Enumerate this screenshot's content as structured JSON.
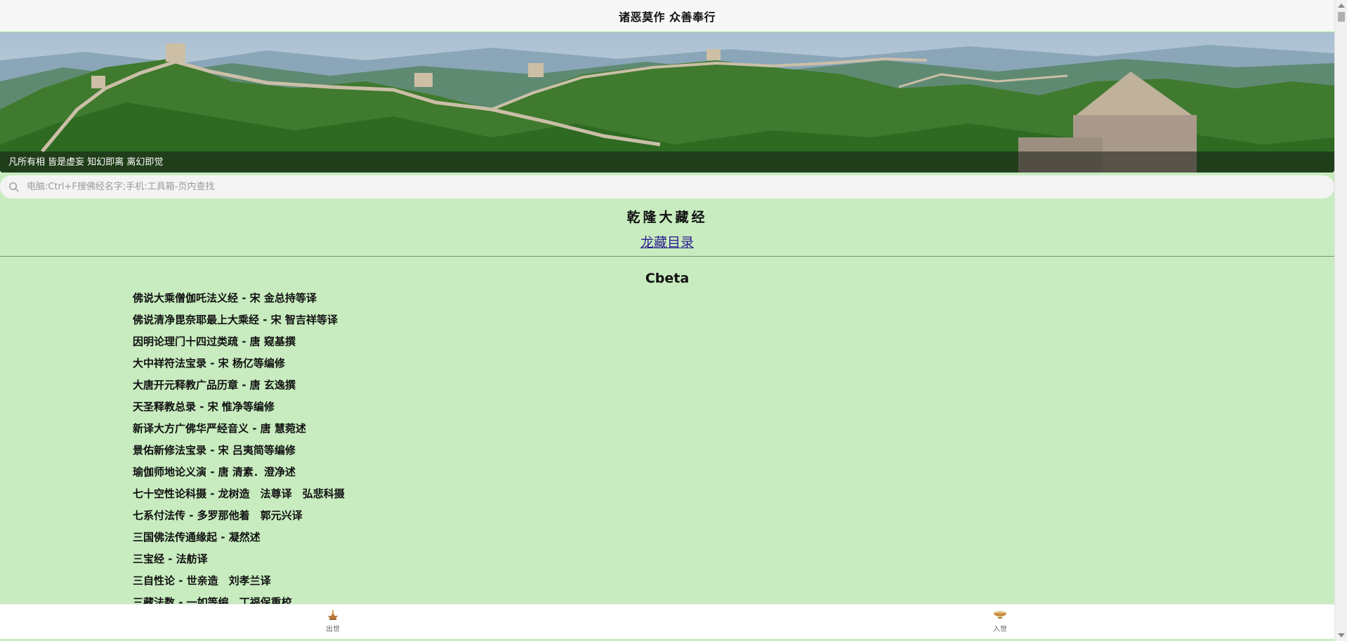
{
  "header": {
    "title": "诸恶莫作 众善奉行"
  },
  "banner": {
    "caption": "凡所有相 皆是虚妄 知幻即离 离幻即觉"
  },
  "search": {
    "placeholder": "电脑:Ctrl+F搜佛经名字;手机:工具箱-页内查找",
    "value": ""
  },
  "main": {
    "collection_title": "乾隆大藏经",
    "catalog_link": "龙藏目录",
    "section_title": "Cbeta",
    "items": [
      "佛说大乘僧伽吒法义经 - 宋 金总持等译",
      "佛说清净毘奈耶最上大乘经 - 宋 智吉祥等译",
      "因明论理门十四过类疏 - 唐 窥基撰",
      "大中祥符法宝录 - 宋 杨亿等编修",
      "大唐开元释教广品历章 - 唐 玄逸撰",
      "天圣释教总录 - 宋 惟净等编修",
      "新译大方广佛华严经音义 - 唐 慧菀述",
      "景佑新修法宝录 - 宋 吕夷简等编修",
      "瑜伽师地论义演 - 唐 清素．澄净述",
      "七十空性论科摄 - 龙树造　法尊译　弘悲科摄",
      "七系付法传 - 多罗那他着　郭元兴译",
      "三国佛法传通缘起 - 凝然述",
      "三宝经 - 法舫译",
      "三自性论 - 世亲造　刘孝兰译",
      "三藏法数 - 一如等编　丁福保重校"
    ]
  },
  "bottom_nav": {
    "left": {
      "label": "出世",
      "icon": "lamp-icon"
    },
    "right": {
      "label": "入世",
      "icon": "bowl-icon"
    }
  },
  "colors": {
    "page_background": "#c8ecbf",
    "link": "#2a1d8f",
    "topbar_background": "#f7f7f7",
    "bottom_nav_background": "#ffffff"
  }
}
